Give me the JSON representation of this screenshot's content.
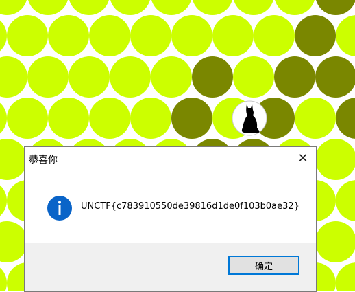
{
  "game": {
    "dot_color_bright": "#ccff00",
    "dot_color_dark": "#7a8700",
    "cat_icon": "cat-silhouette-icon"
  },
  "dialog": {
    "title": "恭喜你",
    "message": "UNCTF{c783910550de39816d1de0f103b0ae32}",
    "ok_label": "确定",
    "info_icon": "info-icon",
    "close_icon": "close-icon"
  }
}
